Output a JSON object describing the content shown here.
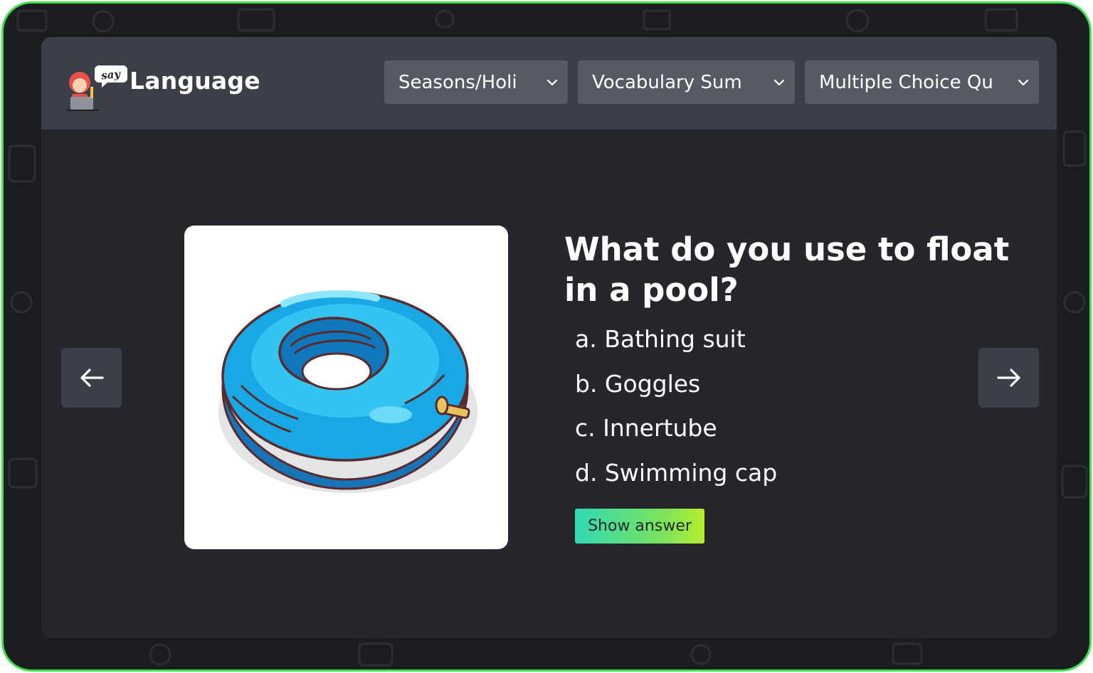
{
  "app": {
    "logo_text": "Language",
    "logo_badge": "say",
    "frame_color": "#3ee04a"
  },
  "header": {
    "dropdowns": [
      {
        "label": "Seasons/Holi"
      },
      {
        "label": "Vocabulary Sum"
      },
      {
        "label": "Multiple Choice Qu"
      }
    ]
  },
  "quiz": {
    "question": "What do you use to float in a pool?",
    "image_icon": "innertube-image",
    "options": [
      {
        "label": "a. Bathing suit"
      },
      {
        "label": "b. Goggles"
      },
      {
        "label": "c. Innertube"
      },
      {
        "label": "d. Swimming cap"
      }
    ],
    "show_answer_label": "Show answer"
  },
  "navigation": {
    "prev_icon": "arrow-left-icon",
    "next_icon": "arrow-right-icon"
  },
  "colors": {
    "card_bg": "#25272d",
    "header_bg": "#3b3f47",
    "dropdown_bg": "#555a63",
    "button_gradient_start": "#30d9b4",
    "button_gradient_end": "#b5ee2e"
  }
}
